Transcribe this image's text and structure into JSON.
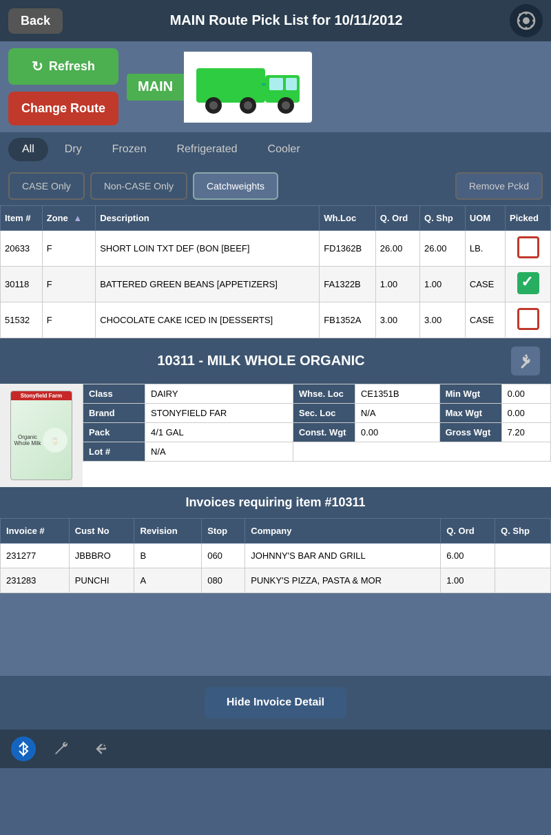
{
  "header": {
    "back_label": "Back",
    "title": "MAIN Route Pick List for 10/11/2012",
    "settings_icon": "⚙"
  },
  "controls": {
    "refresh_label": "Refresh",
    "truck_label": "MAIN",
    "change_route_label": "Change Route"
  },
  "filter_tabs": {
    "tabs": [
      {
        "label": "All",
        "active": true
      },
      {
        "label": "Dry",
        "active": false
      },
      {
        "label": "Frozen",
        "active": false
      },
      {
        "label": "Refrigerated",
        "active": false
      },
      {
        "label": "Cooler",
        "active": false
      }
    ]
  },
  "action_buttons": {
    "case_only": "CASE Only",
    "non_case": "Non-CASE Only",
    "catchweights": "Catchweights",
    "remove_pckd": "Remove Pckd"
  },
  "table": {
    "columns": [
      "Item #",
      "Zone",
      "Description",
      "Wh.Loc",
      "Q. Ord",
      "Q. Shp",
      "UOM",
      "Picked"
    ],
    "rows": [
      {
        "item": "20633",
        "zone": "F",
        "description": "SHORT LOIN TXT DEF (BON [BEEF]",
        "wh_loc": "FD1362B",
        "q_ord": "26.00",
        "q_shp": "26.00",
        "uom": "LB.",
        "picked": "empty"
      },
      {
        "item": "30118",
        "zone": "F",
        "description": "BATTERED GREEN BEANS [APPETIZERS]",
        "wh_loc": "FA1322B",
        "q_ord": "1.00",
        "q_shp": "1.00",
        "uom": "CASE",
        "picked": "checked"
      },
      {
        "item": "51532",
        "zone": "F",
        "description": "CHOCOLATE CAKE ICED IN [DESSERTS]",
        "wh_loc": "FB1352A",
        "q_ord": "3.00",
        "q_shp": "3.00",
        "uom": "CASE",
        "picked": "empty"
      }
    ]
  },
  "detail": {
    "title": "10311 - MILK WHOLE ORGANIC",
    "fields": {
      "class_label": "Class",
      "class_value": "DAIRY",
      "brand_label": "Brand",
      "brand_value": "STONYFIELD FAR",
      "pack_label": "Pack",
      "pack_value": "4/1 GAL",
      "lot_label": "Lot #",
      "lot_value": "N/A",
      "whse_loc_label": "Whse. Loc",
      "whse_loc_value": "CE1351B",
      "sec_loc_label": "Sec. Loc",
      "sec_loc_value": "N/A",
      "const_wgt_label": "Const. Wgt",
      "const_wgt_value": "0.00",
      "min_wgt_label": "Min Wgt",
      "min_wgt_value": "0.00",
      "max_wgt_label": "Max Wgt",
      "max_wgt_value": "0.00",
      "gross_wgt_label": "Gross Wgt",
      "gross_wgt_value": "7.20"
    }
  },
  "invoices": {
    "title": "Invoices requiring item #10311",
    "columns": [
      "Invoice #",
      "Cust No",
      "Revision",
      "Stop",
      "Company",
      "Q. Ord",
      "Q. Shp"
    ],
    "rows": [
      {
        "invoice": "231277",
        "cust": "JBBBRO",
        "revision": "B",
        "stop": "060",
        "company": "JOHNNY'S BAR AND GRILL",
        "q_ord": "6.00",
        "q_shp": ""
      },
      {
        "invoice": "231283",
        "cust": "PUNCHI",
        "revision": "A",
        "stop": "080",
        "company": "PUNKY'S PIZZA, PASTA & MOR",
        "q_ord": "1.00",
        "q_shp": ""
      }
    ]
  },
  "footer": {
    "hide_invoice_label": "Hide Invoice Detail"
  },
  "bottom_nav": {
    "bluetooth": "B",
    "wrench": "🔧",
    "back": "↩"
  }
}
